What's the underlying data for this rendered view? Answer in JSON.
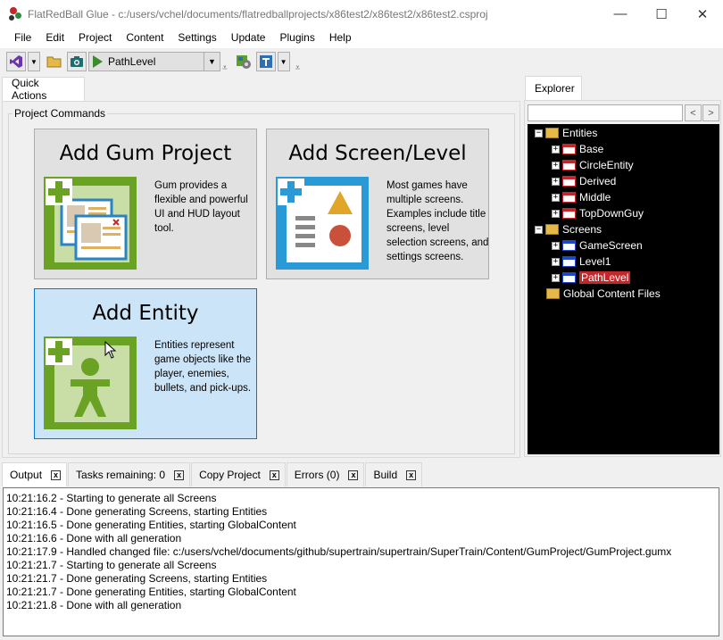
{
  "window": {
    "title": "FlatRedBall Glue - c:/users/vchel/documents/flatredballprojects/x86test2/x86test2/x86test2.csproj",
    "minimize": "—",
    "maximize": "☐",
    "close": "✕"
  },
  "menu": [
    "File",
    "Edit",
    "Project",
    "Content",
    "Settings",
    "Update",
    "Plugins",
    "Help"
  ],
  "toolbar": {
    "screen_select": "PathLevel",
    "icons": [
      "visual-studio-icon",
      "open-folder-icon",
      "camera-icon",
      "play-icon",
      "build-icon",
      "tool-icon"
    ]
  },
  "left_tab": "Quick Actions",
  "group_label": "Project Commands",
  "quick_actions": [
    {
      "title": "Add Gum Project",
      "desc": "Gum provides a flexible and powerful UI and HUD layout tool."
    },
    {
      "title": "Add Screen/Level",
      "desc": "Most games have multiple screens. Examples include title screens, level selection screens, and settings screens."
    },
    {
      "title": "Add Entity",
      "desc": "Entities represent game objects like the player, enemies, bullets, and pick-ups."
    }
  ],
  "explorer": {
    "tab": "Explorer",
    "back": "<",
    "forward": ">",
    "tree": {
      "entities": "Entities",
      "entity_items": [
        "Base",
        "CircleEntity",
        "Derived",
        "Middle",
        "TopDownGuy"
      ],
      "screens": "Screens",
      "screen_items": [
        "GameScreen",
        "Level1",
        "PathLevel"
      ],
      "selected": "PathLevel",
      "global": "Global Content Files"
    }
  },
  "bottom_tabs": [
    "Output",
    "Tasks remaining: 0",
    "Copy Project",
    "Errors (0)",
    "Build"
  ],
  "close_glyph": "x",
  "output_lines": [
    "10:21:16.2 - Starting to generate all Screens",
    "10:21:16.4 - Done generating Screens, starting Entities",
    "10:21:16.5 - Done generating Entities, starting GlobalContent",
    "10:21:16.6 - Done with all generation",
    "10:21:17.9 - Handled changed file: c:/users/vchel/documents/github/supertrain/supertrain/SuperTrain/Content/GumProject/GumProject.gumx",
    "10:21:21.7 - Starting to generate all Screens",
    "10:21:21.7 - Done generating Screens, starting Entities",
    "10:21:21.7 - Done generating Entities, starting GlobalContent",
    "10:21:21.8 - Done with all generation"
  ]
}
